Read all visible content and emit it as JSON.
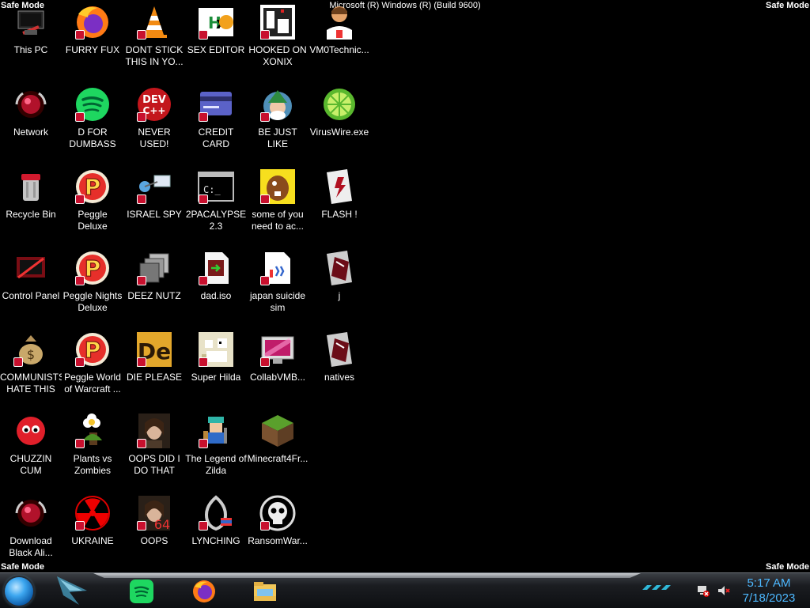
{
  "system": {
    "safe_mode": "Safe Mode",
    "build": "Microsoft (R) Windows (R) (Build 9600)"
  },
  "desktop": {
    "icons": [
      {
        "label": "This PC",
        "icon": "this-pc-icon"
      },
      {
        "label": "Network",
        "icon": "network-icon"
      },
      {
        "label": "Recycle Bin",
        "icon": "recycle-bin-icon"
      },
      {
        "label": "Control Panel",
        "icon": "control-panel-icon"
      },
      {
        "label": "COMMUNISTS\nHATE THIS G...",
        "icon": "money-bag-icon"
      },
      {
        "label": "CHUZZIN\nCUM",
        "icon": "chuzzle-icon"
      },
      {
        "label": "Download\nBlack Ali...",
        "icon": "orb-icon"
      },
      {
        "label": "FURRY FUX",
        "icon": "firefox-icon"
      },
      {
        "label": "D FOR\nDUMBASS",
        "icon": "spotify-icon"
      },
      {
        "label": "Peggle Deluxe",
        "icon": "peggle-icon"
      },
      {
        "label": "Peggle Nights\nDeluxe",
        "icon": "peggle-icon"
      },
      {
        "label": "Peggle World\nof Warcraft ...",
        "icon": "peggle-icon"
      },
      {
        "label": "Plants vs\nZombies",
        "icon": "flower-icon"
      },
      {
        "label": "UKRAINE",
        "icon": "radiation-icon"
      },
      {
        "label": "DONT STICK\nTHIS IN YO...",
        "icon": "vlc-cone-icon"
      },
      {
        "label": "NEVER USED!",
        "icon": "devcpp-icon"
      },
      {
        "label": "ISRAEL SPY",
        "icon": "network-spy-icon"
      },
      {
        "label": "DEEZ NUTZ",
        "icon": "stacked-windows-icon"
      },
      {
        "label": "DIE PLEASE",
        "icon": "de-icon"
      },
      {
        "label": "OOPS DID I\nDO THAT",
        "icon": "portrait-icon"
      },
      {
        "label": "OOPS",
        "icon": "portrait-64-icon"
      },
      {
        "label": "SEX EDITOR",
        "icon": "hxd-icon"
      },
      {
        "label": "CREDIT CARD\nCHECKER",
        "icon": "credit-card-icon"
      },
      {
        "label": "2PACALYPSE\n2.3",
        "icon": "terminal-icon"
      },
      {
        "label": "dad.iso",
        "icon": "iso-file-icon"
      },
      {
        "label": "Super Hilda",
        "icon": "pixel-dog-icon"
      },
      {
        "label": "The Legend of\nZilda",
        "icon": "pixel-hero-icon"
      },
      {
        "label": "LYNCHING",
        "icon": "rope-icon"
      },
      {
        "label": "HOOKED ON\nXONIX",
        "icon": "xonix-icon"
      },
      {
        "label": "BE JUST LIKE\nTHE DUDE!",
        "icon": "elf-icon"
      },
      {
        "label": "some of you\nneed to ac...",
        "icon": "beaver-icon"
      },
      {
        "label": "japan suicide\nsim",
        "icon": "doc-file-icon"
      },
      {
        "label": "CollabVMB...",
        "icon": "vm-screen-icon"
      },
      {
        "label": "Minecraft4Fr...",
        "icon": "grass-block-icon"
      },
      {
        "label": "RansomWar...",
        "icon": "skull-icon"
      },
      {
        "label": "VM0Technic...",
        "icon": "doctor-icon"
      },
      {
        "label": "VirusWire.exe",
        "icon": "limewire-icon"
      },
      {
        "label": "FLASH !",
        "icon": "flash-file-icon"
      },
      {
        "label": "j",
        "icon": "shortcut-file-icon"
      },
      {
        "label": "natives",
        "icon": "shortcut-file-icon"
      }
    ]
  },
  "taskbar": {
    "start": "start-orb-icon",
    "apps": [
      "spotify-icon",
      "firefox-icon",
      "file-explorer-icon"
    ],
    "tray": [
      "network-error-icon",
      "volume-muted-icon"
    ],
    "time": "5:17 AM",
    "date": "7/18/2023"
  },
  "colors": {
    "background": "#000000",
    "clock": "#4db8ff",
    "badge": "#c8102e"
  }
}
